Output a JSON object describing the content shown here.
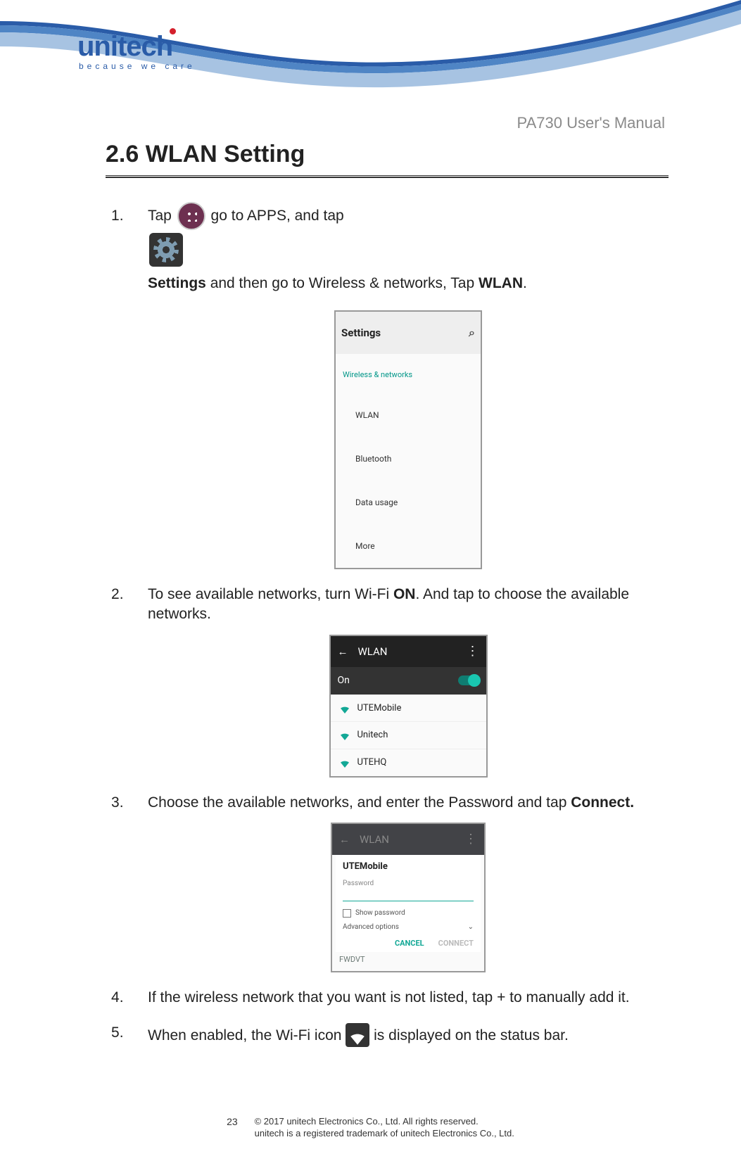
{
  "brand": {
    "name": "unitech",
    "tagline": "because we care"
  },
  "doc": {
    "title": "PA730 User's Manual"
  },
  "section": {
    "heading": "2.6 WLAN Setting"
  },
  "steps": {
    "s1a": "Tap ",
    "s1b": " go to APPS, and tap ",
    "s1c_bold": "Settings",
    "s1d": " and then go to Wireless & networks, Tap ",
    "s1e_bold": "WLAN",
    "s1f": ".",
    "s2a": "To see available networks, turn Wi-Fi ",
    "s2b_bold": "ON",
    "s2c": ". And tap to choose the available networks.",
    "s3a": "Choose the available networks, and enter the Password and tap ",
    "s3b_bold": "Connect.",
    "s4": "If the wireless network that you want is not listed, tap + to manually add it.",
    "s5a": "When enabled, the Wi-Fi icon ",
    "s5b": " is displayed on the status bar."
  },
  "shot1": {
    "title": "Settings",
    "section": "Wireless & networks",
    "items": [
      "WLAN",
      "Bluetooth",
      "Data usage",
      "More"
    ]
  },
  "shot2": {
    "title": "WLAN",
    "state": "On",
    "nets": [
      "UTEMobile",
      "Unitech",
      "UTEHQ"
    ]
  },
  "shot3": {
    "bar_title": "WLAN",
    "ssid": "UTEMobile",
    "pw_label": "Password",
    "show_pw": "Show password",
    "adv": "Advanced options",
    "cancel": "CANCEL",
    "connect": "CONNECT",
    "behind": "FWDVT"
  },
  "footer": {
    "page": "23",
    "line1": "© 2017 unitech Electronics Co., Ltd. All rights reserved.",
    "line2": "unitech is a registered trademark of unitech Electronics Co., Ltd."
  }
}
